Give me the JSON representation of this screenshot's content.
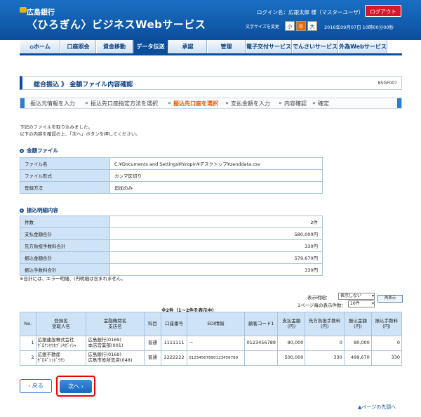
{
  "header": {
    "bank_name": "広島銀行",
    "service_name": "〈ひろぎん〉ビジネスWebサービス",
    "login_text": "ログイン名：広銀太郎 様（マスターユーザ）",
    "logout_label": "ログアウト",
    "font_size_label": "文字サイズを変更",
    "font_small": "小",
    "font_medium": "中",
    "font_large": "大",
    "datetime": "2016年09月07日 10時00分00秒"
  },
  "nav": {
    "home": "ホーム",
    "account": "口座照会",
    "fund": "資金移動",
    "data": "データ伝送",
    "approval": "承認",
    "admin": "管理",
    "edelivery": "電子交付サービス",
    "densai": "でんさいサービス",
    "forex": "外為Webサービス"
  },
  "page": {
    "title": "総合振込 》 金額ファイル内容確認",
    "screen_id": "BSGF007"
  },
  "steps": {
    "s1": "振込元情報を入力",
    "s2": "振込先口座指定方法を選択",
    "s3": "振込先口座を選択",
    "s4": "支払金額を入力",
    "s5": "内容確認",
    "s6": "確定"
  },
  "intro": {
    "line1": "下記のファイルを取り込みました。",
    "line2": "以下の内容を確認の上、「次へ」ボタンを押してください。"
  },
  "file_section": {
    "heading": "金額ファイル",
    "rows": [
      {
        "label": "ファイル名",
        "value": "C:¥Documents and Settings¥hiropin¥デスクトップ¥zenddata.csv"
      },
      {
        "label": "ファイル形式",
        "value": "カンマ区切り"
      },
      {
        "label": "登録方法",
        "value": "追加のみ"
      }
    ]
  },
  "summary_section": {
    "heading": "振込明細内容",
    "rows": [
      {
        "label": "件数",
        "value": "2件"
      },
      {
        "label": "支払金額合計",
        "value": "580,000円"
      },
      {
        "label": "先方負担手数料合計",
        "value": "330円"
      },
      {
        "label": "振込金額合計",
        "value": "579,670円"
      },
      {
        "label": "振込手数料合計",
        "value": "330円"
      }
    ],
    "note": "※合計には、エラー明細、(円明細は含まれません。"
  },
  "list_controls": {
    "display_detail_label": "表示明細：",
    "display_detail_value": "表示しない",
    "per_page_label": "1ページ毎の表示件数：",
    "per_page_value": "10件",
    "redisplay_label": "再表示",
    "count_caption": "全2件（1～2件を表示中）"
  },
  "list": {
    "headers": [
      "No.",
      "登録名\n受取人名",
      "金融機関名\n支店名",
      "科目",
      "口座番号",
      "EDI情報",
      "顧客コード1",
      "支払金額\n(円)",
      "先方負担手数料\n(円)",
      "振込金額\n(円)",
      "振込手数料\n(円)"
    ],
    "rows": [
      [
        "1",
        "広銀建設株式会社\nｾﾞﾛｹﾝｾﾂｶﾌﾞｼｷｶﾞｲｼｬ",
        "広島銀行(0169)\n本店営業部(001)",
        "普通",
        "1111111",
        "－",
        "0123456789",
        "80,000",
        "0",
        "80,000",
        "0"
      ],
      [
        "2",
        "広銀不動産\nｾﾞﾛｷﾞﾝﾌﾄﾞｳｻﾝ",
        "広島銀行(0169)\n広島市役所支店(048)",
        "普通",
        "2222222",
        "01234567890123456789",
        "",
        "500,000",
        "330",
        "499,670",
        "330"
      ]
    ]
  },
  "buttons": {
    "back": "戻る",
    "next": "次へ",
    "pagetop": "ページの先頭へ"
  }
}
